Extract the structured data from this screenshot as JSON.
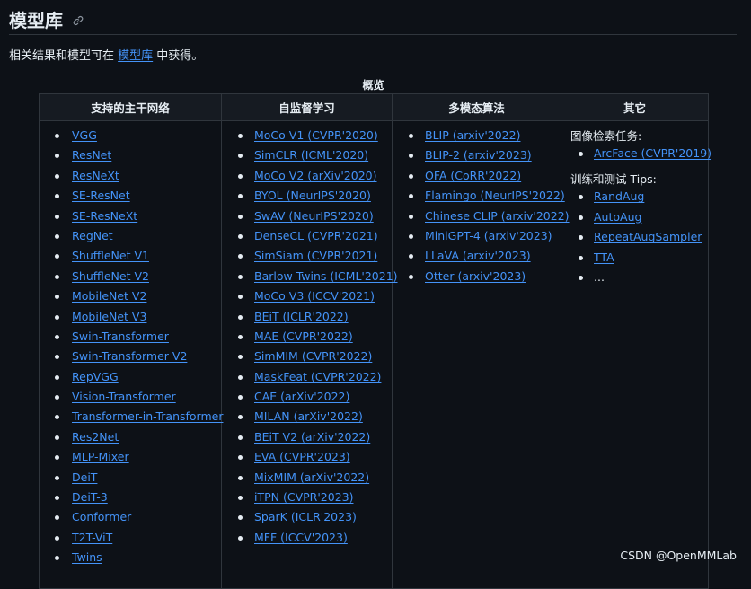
{
  "heading": {
    "title": "模型库"
  },
  "intro": {
    "prefix": "相关结果和模型可在 ",
    "link": "模型库",
    "suffix": " 中获得。"
  },
  "table": {
    "caption": "概览",
    "headers": [
      "支持的主干网络",
      "自监督学习",
      "多模态算法",
      "其它"
    ],
    "backbones": [
      "VGG",
      "ResNet",
      "ResNeXt",
      "SE-ResNet",
      "SE-ResNeXt",
      "RegNet",
      "ShuffleNet V1",
      "ShuffleNet V2",
      "MobileNet V2",
      "MobileNet V3",
      "Swin-Transformer",
      "Swin-Transformer V2",
      "RepVGG",
      "Vision-Transformer",
      "Transformer-in-Transformer",
      "Res2Net",
      "MLP-Mixer",
      "DeiT",
      "DeiT-3",
      "Conformer",
      "T2T-ViT",
      "Twins"
    ],
    "self_supervised": [
      "MoCo V1 (CVPR'2020)",
      "SimCLR (ICML'2020)",
      "MoCo V2 (arXiv'2020)",
      "BYOL (NeurIPS'2020)",
      "SwAV (NeurIPS'2020)",
      "DenseCL (CVPR'2021)",
      "SimSiam (CVPR'2021)",
      "Barlow Twins (ICML'2021)",
      "MoCo V3 (ICCV'2021)",
      "BEiT (ICLR'2022)",
      "MAE (CVPR'2022)",
      "SimMIM (CVPR'2022)",
      "MaskFeat (CVPR'2022)",
      "CAE (arXiv'2022)",
      "MILAN (arXiv'2022)",
      "BEiT V2 (arXiv'2022)",
      "EVA (CVPR'2023)",
      "MixMIM (arXiv'2022)",
      "iTPN (CVPR'2023)",
      "SparK (ICLR'2023)",
      "MFF (ICCV'2023)"
    ],
    "multimodal": [
      "BLIP (arxiv'2022)",
      "BLIP-2 (arxiv'2023)",
      "OFA (CoRR'2022)",
      "Flamingo (NeurIPS'2022)",
      "Chinese CLIP (arxiv'2022)",
      "MiniGPT-4 (arxiv'2023)",
      "LLaVA (arxiv'2023)",
      "Otter (arxiv'2023)"
    ],
    "other": {
      "retrieval_title": "图像检索任务:",
      "retrieval": [
        "ArcFace (CVPR'2019)"
      ],
      "tips_title": "训练和测试 Tips:",
      "tips": [
        "RandAug",
        "AutoAug",
        "RepeatAugSampler",
        "TTA"
      ],
      "ellipsis": "..."
    }
  },
  "watermark": "CSDN @OpenMMLab",
  "colors": {
    "background": "#0d1117",
    "link": "#4493f8",
    "border": "#30363d",
    "text": "#e6edf3"
  }
}
